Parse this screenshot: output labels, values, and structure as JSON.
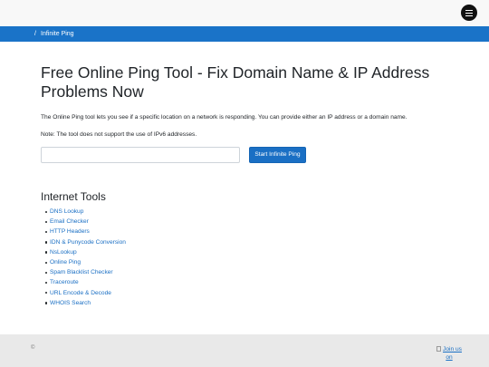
{
  "breadcrumb": {
    "separator": "/",
    "current": "Infinite Ping"
  },
  "main": {
    "title": "Free Online Ping Tool - Fix Domain Name & IP Address Problems Now",
    "intro": "The Online Ping tool lets you see if a specific location on a network is responding. You can provide either an IP address or a domain name.",
    "note": "Note: The tool does not support the use of IPv6 addresses.",
    "host_input": {
      "value": "",
      "placeholder": ""
    },
    "start_button": "Start Infinite Ping"
  },
  "tools": {
    "heading": "Internet Tools",
    "items": [
      "DNS Lookup",
      "Email Checker",
      "HTTP Headers",
      "IDN & Punycode Conversion",
      "NsLookup",
      "Online Ping",
      "Spam Blacklist Checker",
      "Traceroute",
      "URL Encode & Decode",
      "WHOIS Search"
    ]
  },
  "footer": {
    "copyright": "©",
    "join_line1": "Join us",
    "join_line2": "on"
  },
  "icons": {
    "menu": "menu-hamburger-icon",
    "join": "broken-image-icon"
  },
  "colors": {
    "breadcrumb_bar": "#1a73c8",
    "primary_button": "#1a6fc4",
    "link": "#1a6fc4",
    "footer": "#e9e9e9"
  }
}
